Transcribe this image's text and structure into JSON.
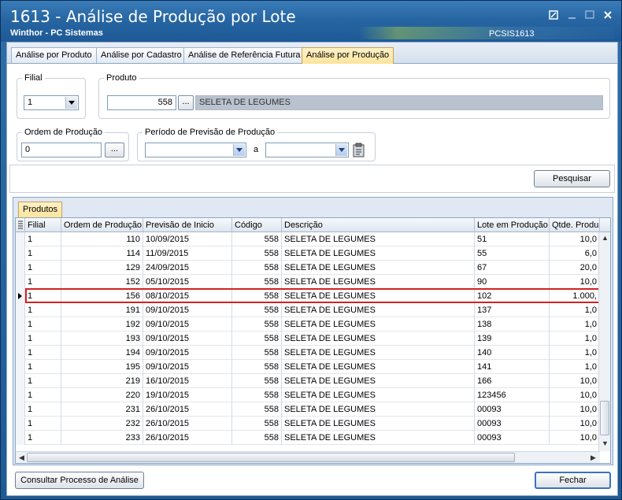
{
  "window": {
    "title": "1613 - Análise de Produção por Lote",
    "subtitle": "Winthor - PC Sistemas",
    "code": "PCSIS1613"
  },
  "tabs": [
    {
      "label": "Análise por Produto"
    },
    {
      "label": "Análise por Cadastro"
    },
    {
      "label": "Análise de Referência Futura"
    },
    {
      "label": "Análise por Produção",
      "active": true
    }
  ],
  "filters": {
    "filial_label": "Filial",
    "filial_value": "1",
    "produto_label": "Produto",
    "produto_code": "558",
    "produto_desc": "SELETA DE LEGUMES",
    "ordem_label": "Ordem de Produção",
    "ordem_value": "0",
    "periodo_label": "Período de Previsão de Produção",
    "periodo_sep": "a",
    "periodo_from": "",
    "periodo_to": "",
    "ellipsis": "..."
  },
  "buttons": {
    "pesquisar": "Pesquisar",
    "consultar": "Consultar Processo de Análise",
    "fechar": "Fechar"
  },
  "grid": {
    "tab": "Produtos",
    "columns": [
      "Filial",
      "Ordem de Produção",
      "Previsão de Inicio",
      "Código",
      "Descrição",
      "Lote em Produção",
      "Qtde. Produz"
    ],
    "selected_row": 4,
    "rows": [
      [
        "1",
        "110",
        "10/09/2015",
        "558",
        "SELETA DE LEGUMES",
        "51",
        "10,0"
      ],
      [
        "1",
        "114",
        "11/09/2015",
        "558",
        "SELETA DE LEGUMES",
        "55",
        "6,0"
      ],
      [
        "1",
        "129",
        "24/09/2015",
        "558",
        "SELETA DE LEGUMES",
        "67",
        "20,0"
      ],
      [
        "1",
        "152",
        "05/10/2015",
        "558",
        "SELETA DE LEGUMES",
        "90",
        "10,0"
      ],
      [
        "1",
        "156",
        "08/10/2015",
        "558",
        "SELETA DE LEGUMES",
        "102",
        "1.000,"
      ],
      [
        "1",
        "191",
        "09/10/2015",
        "558",
        "SELETA DE LEGUMES",
        "137",
        "1,0"
      ],
      [
        "1",
        "192",
        "09/10/2015",
        "558",
        "SELETA DE LEGUMES",
        "138",
        "1,0"
      ],
      [
        "1",
        "193",
        "09/10/2015",
        "558",
        "SELETA DE LEGUMES",
        "139",
        "1,0"
      ],
      [
        "1",
        "194",
        "09/10/2015",
        "558",
        "SELETA DE LEGUMES",
        "140",
        "1,0"
      ],
      [
        "1",
        "195",
        "09/10/2015",
        "558",
        "SELETA DE LEGUMES",
        "141",
        "1,0"
      ],
      [
        "1",
        "219",
        "16/10/2015",
        "558",
        "SELETA DE LEGUMES",
        "166",
        "10,0"
      ],
      [
        "1",
        "220",
        "19/10/2015",
        "558",
        "SELETA DE LEGUMES",
        "123456",
        "10,0"
      ],
      [
        "1",
        "231",
        "26/10/2015",
        "558",
        "SELETA DE LEGUMES",
        "00093",
        "10,0"
      ],
      [
        "1",
        "232",
        "26/10/2015",
        "558",
        "SELETA DE LEGUMES",
        "00093",
        "10,0"
      ],
      [
        "1",
        "233",
        "26/10/2015",
        "558",
        "SELETA DE LEGUMES",
        "00093",
        "10,0"
      ]
    ]
  }
}
